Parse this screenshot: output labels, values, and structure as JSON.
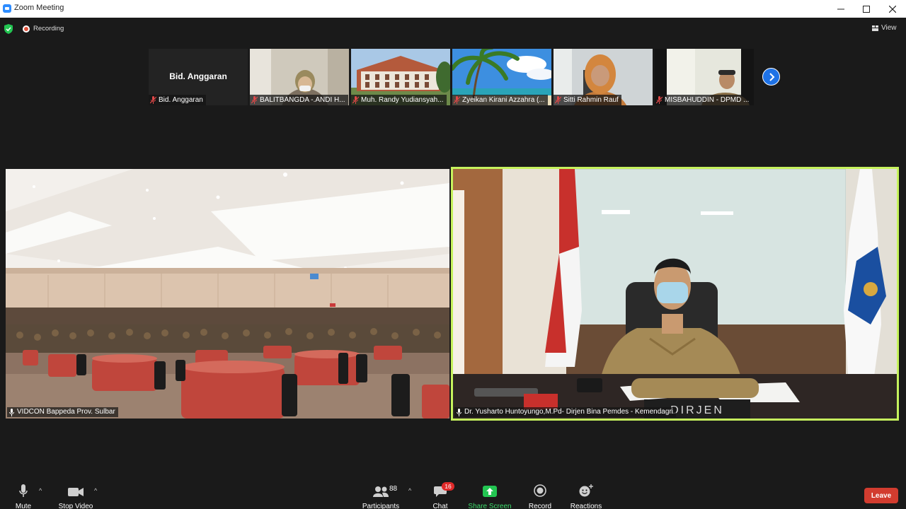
{
  "window": {
    "title": "Zoom Meeting"
  },
  "topbar": {
    "recording_label": "Recording",
    "view_label": "View"
  },
  "thumbnails": [
    {
      "name": "Bid. Anggaran",
      "display_name": "Bid. Anggaran",
      "has_video": false
    },
    {
      "name": "BALITBANGDA -.ANDI H...",
      "has_video": true
    },
    {
      "name": "Muh. Randy Yudiansyah...",
      "has_video": true
    },
    {
      "name": "Zyeikan Kirani Azzahra (...",
      "has_video": true
    },
    {
      "name": "Sitti Rahmin Rauf",
      "has_video": true
    },
    {
      "name": "MISBAHUDDIN - DPMD ...",
      "has_video": true
    }
  ],
  "main_videos": [
    {
      "name": "VIDCON Bappeda Prov. Sulbar",
      "active_speaker": false
    },
    {
      "name": "Dr. Yusharto Huntoyungo,M.Pd- Dirjen Bina Pemdes - Kemendagri",
      "active_speaker": true,
      "nameplate": "DIRJEN"
    }
  ],
  "toolbar": {
    "mute_label": "Mute",
    "video_label": "Stop Video",
    "participants_label": "Participants",
    "participants_count": "88",
    "chat_label": "Chat",
    "chat_badge": "16",
    "share_label": "Share Screen",
    "record_label": "Record",
    "reactions_label": "Reactions",
    "leave_label": "Leave"
  },
  "colors": {
    "accent": "#2D8CFF",
    "active_border": "#c6f25d",
    "share_green": "#23c552",
    "leave_red": "#d23c2f"
  }
}
